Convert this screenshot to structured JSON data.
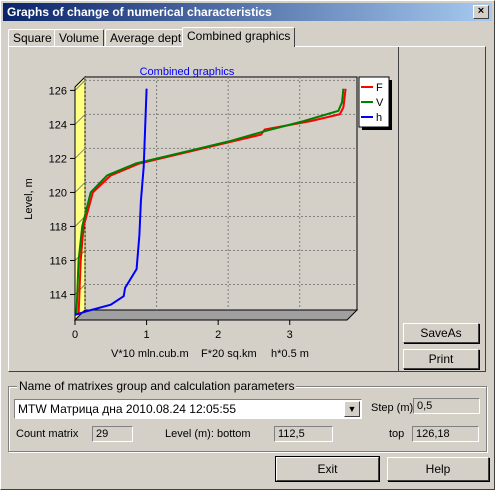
{
  "window": {
    "title": "Graphs of change of numerical characteristics",
    "close_glyph": "×"
  },
  "tabs": [
    {
      "label": "Square",
      "active": false
    },
    {
      "label": "Volume",
      "active": false
    },
    {
      "label": "Average depth",
      "active": false
    },
    {
      "label": "Combined graphics",
      "active": true
    }
  ],
  "chart": {
    "title": "Combined graphics",
    "ylabel": "Level, m",
    "xlabel_parts": [
      "V*10 mln.cub.m",
      "F*20 sq.km",
      "h*0.5 m"
    ],
    "y_ticks": [
      "126",
      "124",
      "122",
      "120",
      "118",
      "116",
      "114"
    ],
    "x_ticks": [
      "0",
      "1",
      "2",
      "3"
    ]
  },
  "chart_data": {
    "type": "line",
    "title": "Combined graphics",
    "xlabel": "V*10 mln.cub.m   F*20 sq.km   h*0.5 m",
    "ylabel": "Level, m",
    "xlim": [
      0,
      3.8
    ],
    "ylim": [
      112.5,
      126.2
    ],
    "grid": true,
    "legend_position": "top-right",
    "series": [
      {
        "name": "F",
        "color": "#ff0000",
        "x": [
          0.05,
          0.08,
          0.12,
          0.25,
          0.5,
          0.9,
          1.5,
          2.2,
          2.6,
          2.65,
          3.3,
          3.7,
          3.75,
          3.78
        ],
        "y": [
          112.8,
          116.0,
          118.0,
          120.0,
          121.0,
          121.7,
          122.3,
          123.0,
          123.4,
          123.7,
          124.2,
          124.6,
          125.0,
          126.1
        ]
      },
      {
        "name": "V",
        "color": "#008000",
        "x": [
          0.02,
          0.05,
          0.1,
          0.22,
          0.45,
          0.85,
          1.45,
          2.15,
          2.65,
          3.2,
          3.68,
          3.73,
          3.75
        ],
        "y": [
          112.8,
          116.0,
          118.0,
          120.0,
          121.0,
          121.7,
          122.3,
          123.0,
          123.6,
          124.2,
          124.8,
          125.3,
          126.1
        ]
      },
      {
        "name": "h",
        "color": "#0000ff",
        "x": [
          0.0,
          0.15,
          0.5,
          0.68,
          0.7,
          0.76,
          0.86,
          0.9,
          0.92,
          0.96,
          1.0
        ],
        "y": [
          112.8,
          113.0,
          113.4,
          113.9,
          114.4,
          114.8,
          115.5,
          117.5,
          119.5,
          121.5,
          126.1
        ]
      }
    ]
  },
  "buttons": {
    "saveas": "SaveAs",
    "print": "Print",
    "exit": "Exit",
    "help": "Help"
  },
  "params": {
    "legend": "Name of matrixes group and calculation parameters",
    "group_value": "MTW Матрица дна 2010.08.24 12:05:55",
    "step_label": "Step (m)",
    "step_value": "0,5",
    "count_label": "Count matrix",
    "count_value": "29",
    "bottom_label": "Level (m): bottom",
    "bottom_value": "112,5",
    "top_label": "top",
    "top_value": "126,18"
  }
}
